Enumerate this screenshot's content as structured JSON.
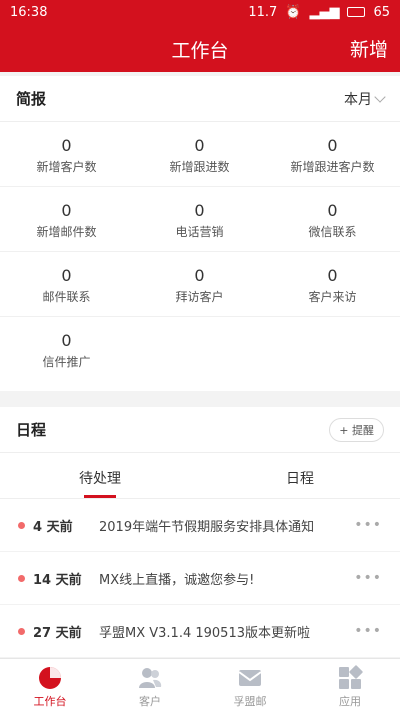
{
  "status_bar": {
    "time": "16:38",
    "speed": "11.7",
    "battery": "65"
  },
  "app_bar": {
    "title": "工作台",
    "action": "新增"
  },
  "summary": {
    "title": "简报",
    "period": "本月",
    "stats": [
      {
        "value": "0",
        "label": "新增客户数"
      },
      {
        "value": "0",
        "label": "新增跟进数"
      },
      {
        "value": "0",
        "label": "新增跟进客户数"
      },
      {
        "value": "0",
        "label": "新增邮件数"
      },
      {
        "value": "0",
        "label": "电话营销"
      },
      {
        "value": "0",
        "label": "微信联系"
      },
      {
        "value": "0",
        "label": "邮件联系"
      },
      {
        "value": "0",
        "label": "拜访客户"
      },
      {
        "value": "0",
        "label": "客户来访"
      },
      {
        "value": "0",
        "label": "信件推广"
      }
    ]
  },
  "schedule": {
    "title": "日程",
    "remind_label": "+ 提醒",
    "tabs": [
      {
        "label": "待处理",
        "active": true
      },
      {
        "label": "日程",
        "active": false
      }
    ],
    "items": [
      {
        "days": "4 天前",
        "text": "2019年端午节假期服务安排具体通知"
      },
      {
        "days": "14 天前",
        "text": "MX线上直播，诚邀您参与!"
      },
      {
        "days": "27 天前",
        "text": "孚盟MX V3.1.4 190513版本更新啦"
      }
    ]
  },
  "bottom_nav": [
    {
      "label": "工作台",
      "icon": "dashboard-icon",
      "active": true
    },
    {
      "label": "客户",
      "icon": "customers-icon",
      "active": false
    },
    {
      "label": "孚盟邮",
      "icon": "mail-icon",
      "active": false
    },
    {
      "label": "应用",
      "icon": "apps-icon",
      "active": false
    }
  ],
  "colors": {
    "brand": "#d3111e",
    "dot": "#f26a6a"
  }
}
